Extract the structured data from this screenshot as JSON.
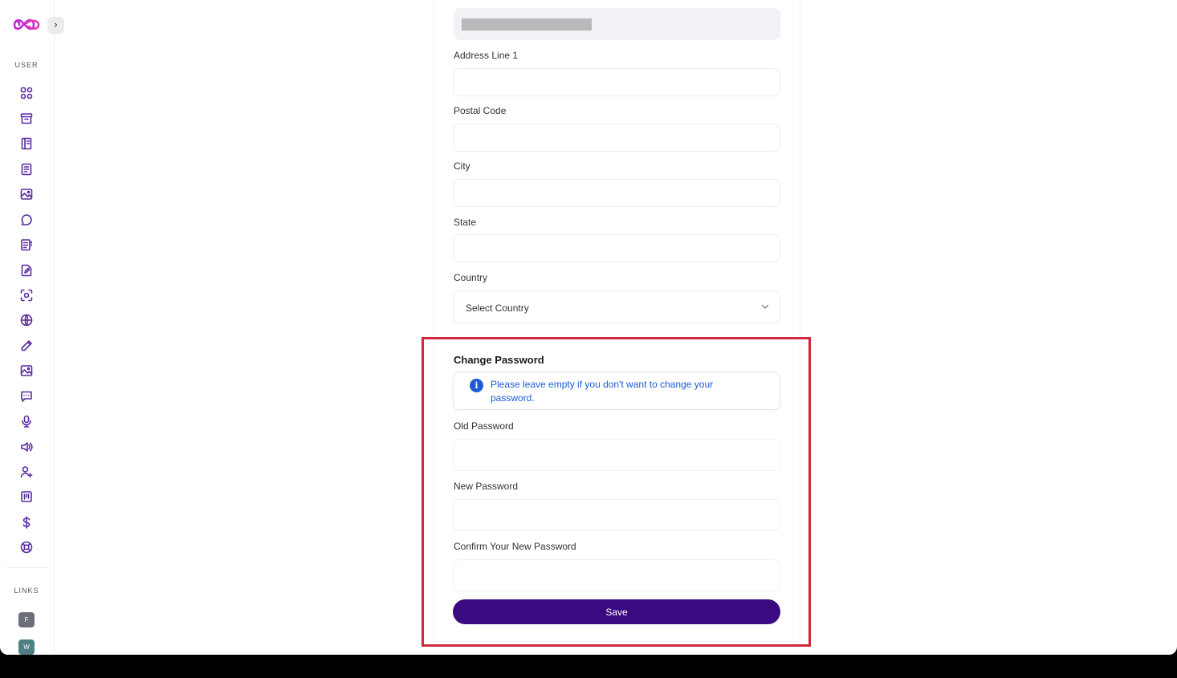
{
  "sidebar": {
    "user_label": "USER",
    "links_label": "LINKS",
    "collapse_icon": "chevron-right-icon",
    "collapse_glyph": "›",
    "nav_icons": [
      "dashboard-grid-icon",
      "archive-box-icon",
      "book-icon",
      "document-icon",
      "image-icon",
      "chat-bubble-icon",
      "document-list-icon",
      "edit-document-icon",
      "scan-face-icon",
      "globe-icon",
      "pencil-icon",
      "image-icon",
      "message-square-icon",
      "microphone-icon",
      "speaker-icon",
      "add-user-icon",
      "kanban-icon",
      "dollar-icon",
      "lifebuoy-icon"
    ],
    "links": [
      {
        "label": "F",
        "color": "#6b6f78"
      },
      {
        "label": "W",
        "color": "#4f7f82"
      }
    ]
  },
  "form": {
    "address_line1_label": "Address Line 1",
    "postal_code_label": "Postal Code",
    "city_label": "City",
    "state_label": "State",
    "country_label": "Country",
    "country_select_value": "Select Country"
  },
  "change_password": {
    "title": "Change Password",
    "info_text": "Please leave empty if you don't want to change your password.",
    "info_icon": "i",
    "old_password_label": "Old Password",
    "new_password_label": "New Password",
    "confirm_password_label": "Confirm Your New Password",
    "save_label": "Save"
  },
  "colors": {
    "accent": "#3a0a80",
    "info_blue": "#1d5bd6",
    "highlight_red": "#d0283e",
    "icon_purple": "#5a2ca0"
  }
}
